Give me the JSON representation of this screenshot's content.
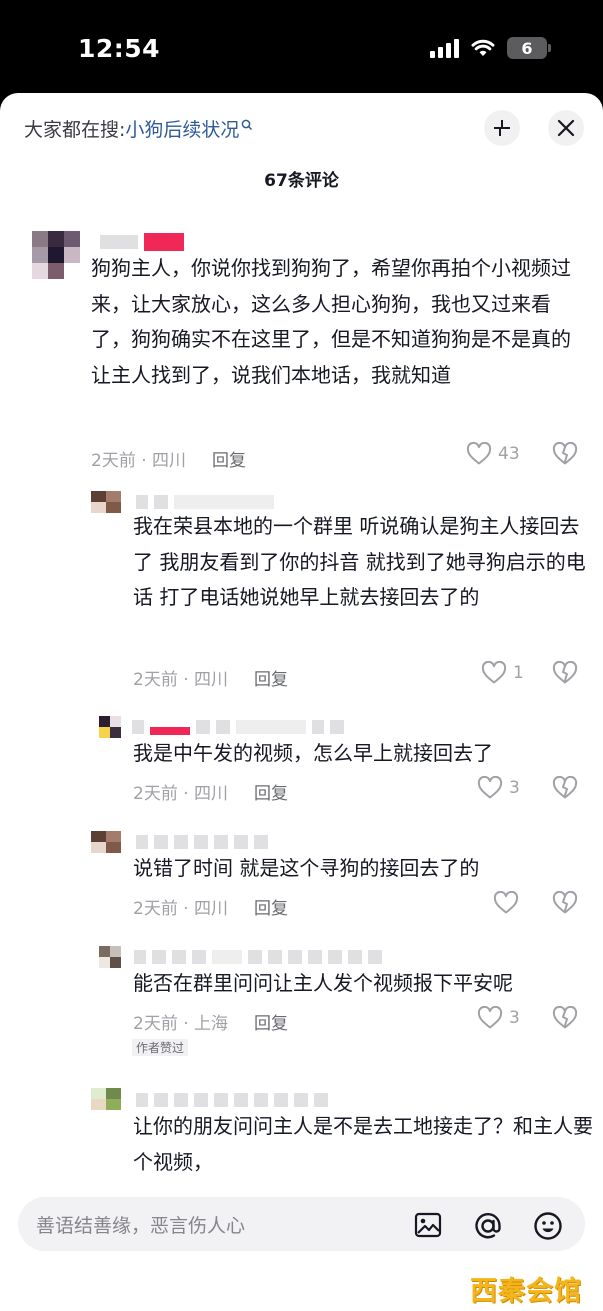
{
  "status_bar": {
    "time": "12:54",
    "battery": "6"
  },
  "header": {
    "search_prefix": "大家都在搜:",
    "search_term": "小狗后续状况",
    "comment_count": "67条评论"
  },
  "comments": [
    {
      "text": "狗狗主人，你说你找到狗狗了，希望你再拍个小视频过来，让大家放心，这么多人担心狗狗，我也又过来看了，狗狗确实不在这里了，但是不知道狗狗是不是真的让主人找到了，说我们本地话，我就知道",
      "time": "2天前 · 四川",
      "reply": "回复",
      "likes": "43"
    },
    {
      "text": "我在荣县本地的一个群里 听说确认是狗主人接回去了 我朋友看到了你的抖音 就找到了她寻狗启示的电话 打了电话她说她早上就去接回去了的",
      "time": "2天前 · 四川",
      "reply": "回复",
      "likes": "1"
    },
    {
      "text": "我是中午发的视频，怎么早上就接回去了",
      "time": "2天前 · 四川",
      "reply": "回复",
      "likes": "3"
    },
    {
      "text": "说错了时间 就是这个寻狗的接回去了的",
      "time": "2天前 · 四川",
      "reply": "回复",
      "likes": ""
    },
    {
      "text": "能否在群里问问让主人发个视频报下平安呢",
      "time": "2天前 · 上海",
      "reply": "回复",
      "likes": "3",
      "tag": "作者赞过"
    },
    {
      "text": "让你的朋友问问主人是不是去工地接走了？和主人要个视频，",
      "time": "",
      "reply": "",
      "likes": ""
    }
  ],
  "input": {
    "placeholder": "善语结善缘，恶言伤人心"
  },
  "icons": [
    "search-icon",
    "collapse-icon",
    "close-icon",
    "heart-icon",
    "broken-heart-icon",
    "image-icon",
    "at-icon",
    "emoji-icon"
  ],
  "watermark": "西秦会馆",
  "colors": {
    "link": "#2f5b98",
    "watermark": "#f4b51c",
    "muted": "#a0a1a6"
  }
}
